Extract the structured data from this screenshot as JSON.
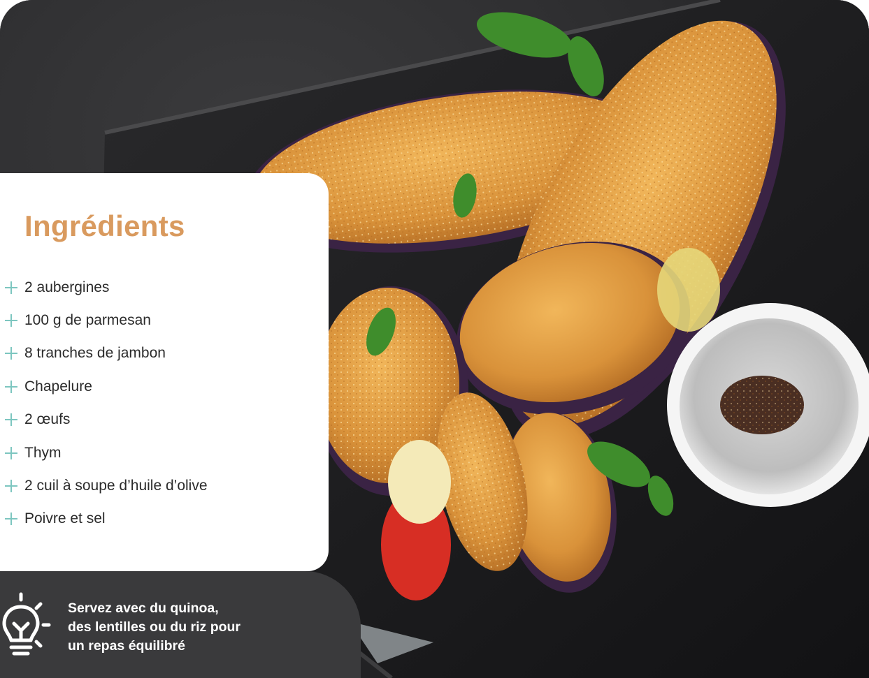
{
  "ingredients": {
    "title": "Ingrédients",
    "items": [
      "2 aubergines",
      "100 g de parmesan",
      "8 tranches de jambon",
      "Chapelure",
      "2 œufs",
      "Thym",
      "2 cuil à soupe d’huile d’olive",
      "Poivre et sel"
    ]
  },
  "tip": {
    "line1": "Servez avec du quinoa,",
    "line2": "des lentilles ou du riz pour",
    "line3": "un repas équilibré",
    "icon": "lightbulb-icon"
  },
  "photo": {
    "subject": "breaded-eggplant-gratin-on-baking-tray",
    "icon": "food-photo"
  },
  "colors": {
    "title": "#d99a5e",
    "accent": "#7dc6c0",
    "tip_background": "#3a3a3c",
    "text": "#2b2b2b"
  }
}
